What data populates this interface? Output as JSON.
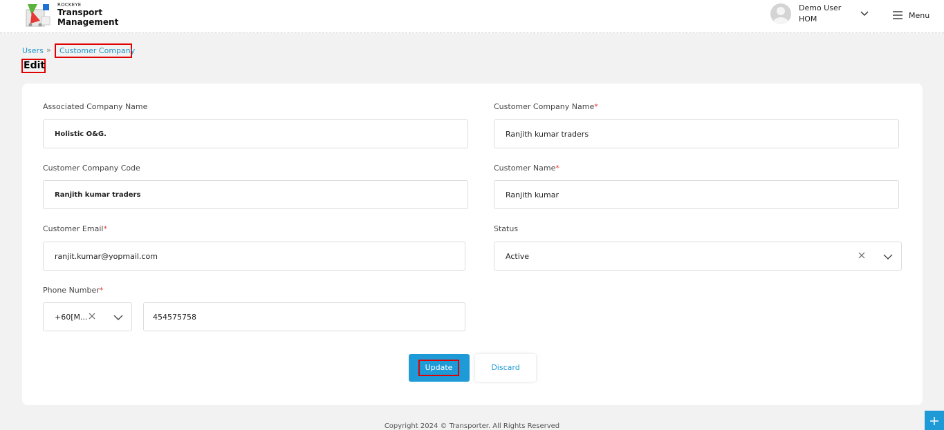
{
  "header": {
    "brand_small": "ROCKEYE",
    "brand_line1": "Transport",
    "brand_line2": "Management",
    "user_name": "Demo User",
    "user_role": "HOM",
    "menu_label": "Menu"
  },
  "breadcrumb": {
    "parent": "Users",
    "separator": "»",
    "current": "Customer Company"
  },
  "page_title": "Edit",
  "form": {
    "associated_company_name": {
      "label": "Associated Company Name",
      "value": "Holistic O&G."
    },
    "customer_company_name": {
      "label": "Customer Company Name",
      "required": "*",
      "value": "Ranjith kumar traders"
    },
    "customer_company_code": {
      "label": "Customer Company Code",
      "value": "Ranjith kumar traders"
    },
    "customer_name": {
      "label": "Customer Name",
      "required": "*",
      "value": "Ranjith kumar"
    },
    "customer_email": {
      "label": "Customer Email",
      "required": "*",
      "value": "ranjit.kumar@yopmail.com"
    },
    "status": {
      "label": "Status",
      "value": "Active"
    },
    "phone_number": {
      "label": "Phone Number",
      "required": "*",
      "country_code": "+60[M...",
      "value": "454575758"
    }
  },
  "actions": {
    "update_label": "Update",
    "discard_label": "Discard"
  },
  "footer": {
    "copyright": "Copyright 2024 © Transporter. All Rights Reserved"
  },
  "colors": {
    "accent": "#1e9ad6",
    "link": "#2196c9",
    "highlight_border": "#e00000",
    "required": "#e53935"
  },
  "icons": [
    "logo-icon",
    "avatar-icon",
    "chevron-down-icon",
    "menu-icon",
    "close-icon",
    "plus-icon"
  ]
}
